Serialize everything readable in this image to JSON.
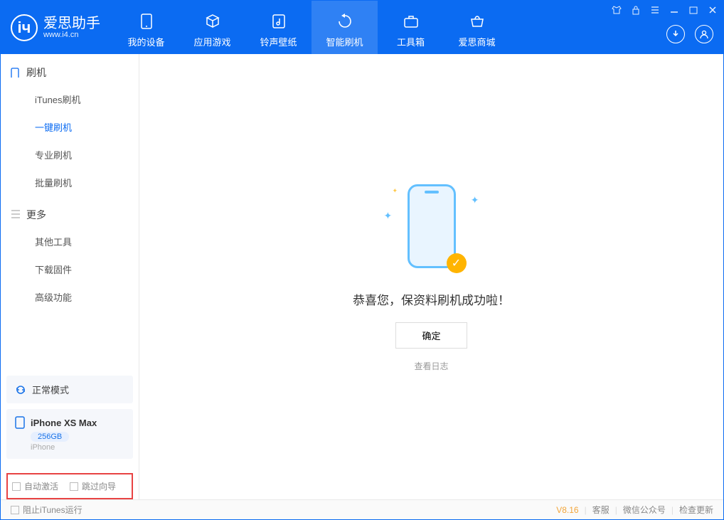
{
  "app": {
    "name_cn": "爱思助手",
    "name_en": "www.i4.cn",
    "logo_letter": "iч"
  },
  "tabs": [
    {
      "label": "我的设备"
    },
    {
      "label": "应用游戏"
    },
    {
      "label": "铃声壁纸"
    },
    {
      "label": "智能刷机"
    },
    {
      "label": "工具箱"
    },
    {
      "label": "爱思商城"
    }
  ],
  "sidebar": {
    "section1": "刷机",
    "items1": [
      {
        "label": "iTunes刷机"
      },
      {
        "label": "一键刷机"
      },
      {
        "label": "专业刷机"
      },
      {
        "label": "批量刷机"
      }
    ],
    "section2": "更多",
    "items2": [
      {
        "label": "其他工具"
      },
      {
        "label": "下载固件"
      },
      {
        "label": "高级功能"
      }
    ]
  },
  "device": {
    "mode": "正常模式",
    "name": "iPhone XS Max",
    "storage": "256GB",
    "type": "iPhone"
  },
  "options": {
    "auto_activate": "自动激活",
    "skip_wizard": "跳过向导"
  },
  "main": {
    "message": "恭喜您，保资料刷机成功啦！",
    "ok": "确定",
    "view_log": "查看日志"
  },
  "footer": {
    "block_itunes": "阻止iTunes运行",
    "version": "V8.16",
    "links": [
      "客服",
      "微信公众号",
      "检查更新"
    ]
  }
}
